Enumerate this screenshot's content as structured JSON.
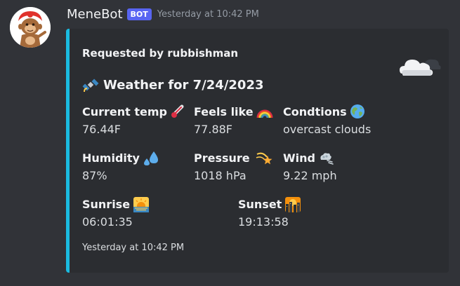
{
  "message": {
    "username": "MeneBot",
    "bot_tag": "BOT",
    "timestamp": "Yesterday at 10:42 PM"
  },
  "embed": {
    "accent_color": "#1abbe0",
    "author": "Requested by rubbishman",
    "thumbnail_icon": "cloud-icon",
    "title_icon": "satellite-icon",
    "title": "Weather for 7/24/2023",
    "fields": {
      "current_temp": {
        "name": "Current temp",
        "value": "76.44F",
        "icon": "thermometer-icon"
      },
      "feels_like": {
        "name": "Feels like",
        "value": "77.88F",
        "icon": "rainbow-icon"
      },
      "conditions": {
        "name": "Condtions",
        "value": "overcast clouds",
        "icon": "globe-icon"
      },
      "humidity": {
        "name": "Humidity",
        "value": "87%",
        "icon": "droplets-icon"
      },
      "pressure": {
        "name": "Pressure",
        "value": "1018 hPa",
        "icon": "dizzy-star-icon"
      },
      "wind": {
        "name": "Wind",
        "value": "9.22 mph",
        "icon": "wind-icon"
      },
      "sunrise": {
        "name": "Sunrise",
        "value": "06:01:35",
        "icon": "sunrise-icon"
      },
      "sunset": {
        "name": "Sunset",
        "value": "19:13:58",
        "icon": "city-sunset-icon"
      }
    },
    "footer": "Yesterday at 10:42 PM"
  },
  "colors": {
    "background": "#313338",
    "embed_background": "#2b2d31",
    "bot_tag": "#5865f2"
  }
}
